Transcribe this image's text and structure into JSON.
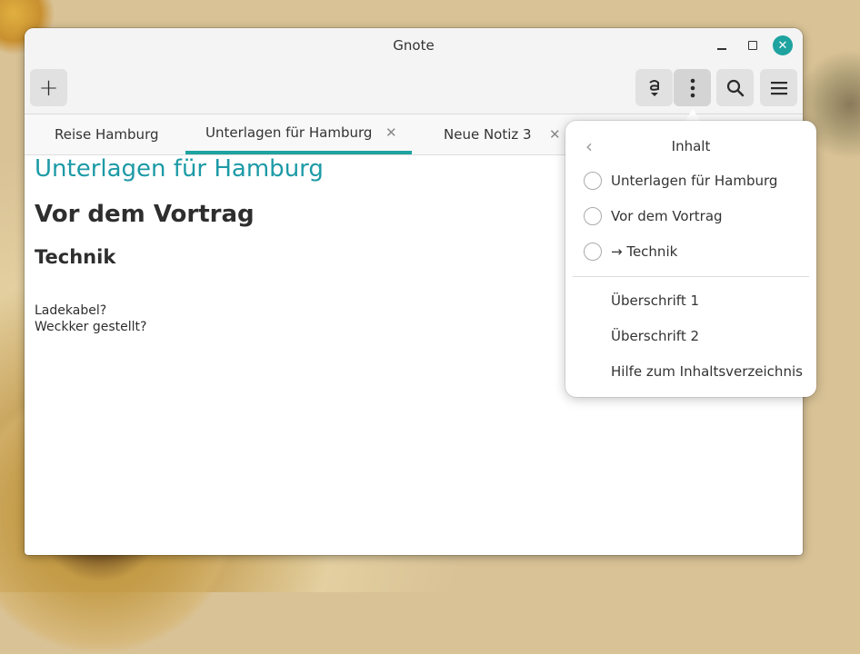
{
  "window": {
    "title": "Gnote",
    "controls": {
      "close_glyph": "✕"
    }
  },
  "toolbar": {
    "new_note_glyph": "+",
    "icons": [
      "text-format-icon",
      "more-vertical-icon",
      "search-icon",
      "hamburger-menu-icon"
    ]
  },
  "tabs": [
    {
      "label": "Reise Hamburg",
      "active": false
    },
    {
      "label": "Unterlagen für Hamburg",
      "active": true,
      "close_glyph": "✕"
    },
    {
      "label": "Neue Notiz 3",
      "active": false,
      "close_glyph": "✕"
    }
  ],
  "note": {
    "title": "Unterlagen für Hamburg",
    "heading1": "Vor dem Vortrag",
    "heading2": "Technik",
    "lines": [
      "Ladekabel?",
      "Weckker gestellt?"
    ]
  },
  "popover": {
    "back_glyph": "‹",
    "heading": "Inhalt",
    "toc": [
      "Unterlagen für Hamburg",
      "Vor dem Vortrag",
      "→ Technik"
    ],
    "actions": [
      "Überschrift 1",
      "Überschrift 2",
      "Hilfe zum Inhaltsverzeichnis"
    ]
  },
  "colors": {
    "accent": "#1ea3a0",
    "title_teal": "#1d9aa6"
  }
}
